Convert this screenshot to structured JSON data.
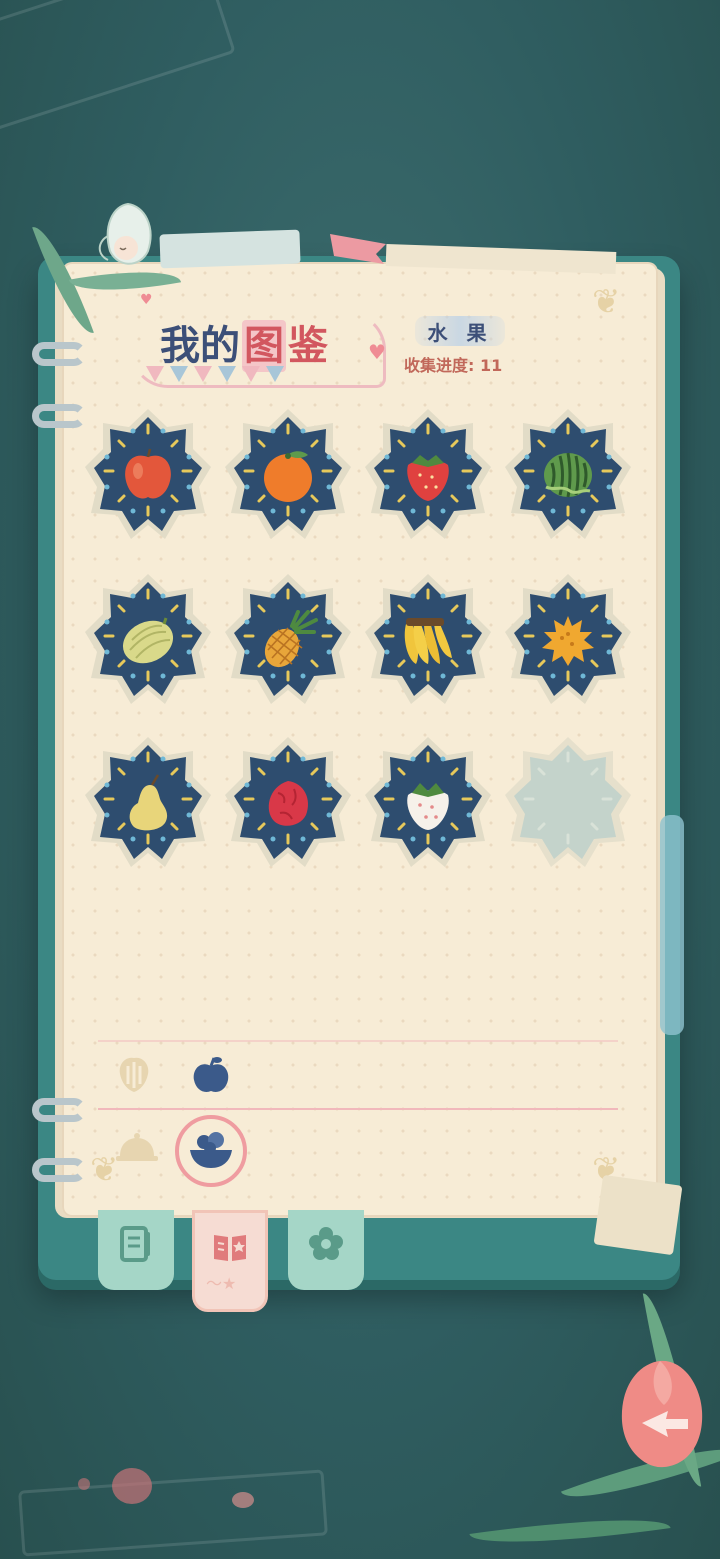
{
  "title": {
    "part1": "我的",
    "part2": "图",
    "part3": "鉴"
  },
  "category": "水 果",
  "progress": "收集进度: 11",
  "fruits": [
    {
      "name": "apple",
      "icon": "apple-icon",
      "collected": true
    },
    {
      "name": "orange",
      "icon": "orange-icon",
      "collected": true
    },
    {
      "name": "strawberry",
      "icon": "strawberry-icon",
      "collected": true
    },
    {
      "name": "watermelon",
      "icon": "watermelon-icon",
      "collected": true
    },
    {
      "name": "melon",
      "icon": "melon-icon",
      "collected": true
    },
    {
      "name": "pineapple",
      "icon": "pineapple-icon",
      "collected": true
    },
    {
      "name": "banana",
      "icon": "banana-icon",
      "collected": true
    },
    {
      "name": "horned-melon",
      "icon": "horned-melon-icon",
      "collected": true
    },
    {
      "name": "pear",
      "icon": "pear-icon",
      "collected": true
    },
    {
      "name": "pitaya",
      "icon": "pitaya-icon",
      "collected": true
    },
    {
      "name": "white-strawberry",
      "icon": "white-strawberry-icon",
      "collected": true
    },
    {
      "name": "empty",
      "icon": "empty-slot",
      "collected": false
    }
  ],
  "colors": {
    "badge_dark": "#2e4d6f",
    "badge_rim": "#e2dcc7",
    "accent_pink": "#ef9ca0",
    "title_blue": "#3c4f78",
    "progress_orange": "#c1685a"
  }
}
